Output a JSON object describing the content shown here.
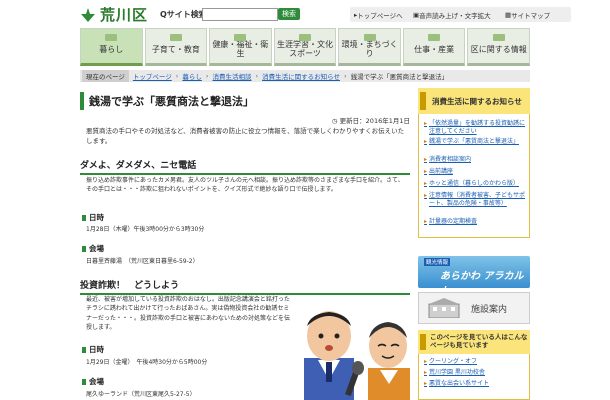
{
  "header": {
    "site_name": "荒川区",
    "search_label": "Qサイト検索",
    "search_placeholder": "",
    "search_button": "検索",
    "links": {
      "top": "トップページへ",
      "voice": "音声読み上げ・文字拡大",
      "sitemap": "サイトマップ"
    }
  },
  "nav": {
    "items": [
      {
        "label": "暮らし",
        "active": true
      },
      {
        "label": "子育て・教育"
      },
      {
        "label": "健康・福祉・衛生"
      },
      {
        "label": "生涯学習・文化\nスポーツ"
      },
      {
        "label": "環境・まちづくり"
      },
      {
        "label": "仕事・産業"
      },
      {
        "label": "区に関する情報"
      }
    ]
  },
  "breadcrumb": {
    "current_label": "現在のページ",
    "items": [
      "トップページ",
      "暮らし",
      "消費生活相談",
      "消費生活に関するお知らせ"
    ],
    "current": "銭湯で学ぶ「悪質商法と撃退法」"
  },
  "main": {
    "title": "銭湯で学ぶ「悪質商法と撃退法」",
    "updated": "更新日：2016年1月1日",
    "intro": "悪質商法の手口やその対処法など、消費者被害の防止に役立つ情報を、落語で楽しくわかりやすくお伝えいたします。",
    "sections": {
      "dame": {
        "heading": "ダメよ、ダメダメ、ニセ電話",
        "para": "振り込め詐欺事件にあったカメ男君。友人のツル子さんの元へ相談。振り込め詐欺等のさまざまな手口を紹介。さて、その手口とは・・・詐欺に狙われないポイントを、クイズ形式で絶妙な語り口で伝授します。",
        "date_heading": "日時",
        "date": "1月28日（木曜）午後3時00分から3時30分",
        "venue_heading": "会場",
        "venue": "日暮里斉藤湯　（荒川区東日暮里6-59-2）"
      },
      "invest": {
        "heading": "投資詐欺！　どうしよう",
        "para": "最近、被害が増加している投資詐欺のおはなし。出版記念講演会と銘打ったチラシに誘われて出かけて行ったおばあさん。実は偽物投資会社の勧誘セミナーだった・・・。投資詐欺の手口と被害にあわないための対処策などを伝授します。",
        "date_heading": "日時",
        "date": "1月29日（金曜）　午後4時30分から5時00分",
        "venue_heading": "会場",
        "venue": "尾久ゆーランド（荒川区東尾久5-27-5）"
      }
    }
  },
  "sidebar": {
    "heading": "消費生活に関するお知らせ",
    "items": [
      "「依然過量」を勧誘する投資勧誘に注意してください",
      "銭湯で学ぶ「悪質商法と撃退法」",
      "消費者相談案内",
      "出前講座",
      "ホッと通信（暮らしのかわら版）",
      "注意情報（消費者被害、子どもサポート、製品の危険・事故等）",
      "計量器の定期検査"
    ],
    "banner_tour_tag": "観光情報",
    "banner_tour_text": "あらかわ アラカルト",
    "banner_facility": "施設案内",
    "panel_heading": "このページを見ている人はこんなページも見ています",
    "panel_items": [
      "クーリング・オフ",
      "荒川学園 黒川功校舎",
      "悪質な出会い系サイト"
    ]
  },
  "colors": {
    "brand_green": "#2e8b3a",
    "sidebar_yellow": "#fbe47a",
    "link_blue": "#1a5fb4"
  }
}
